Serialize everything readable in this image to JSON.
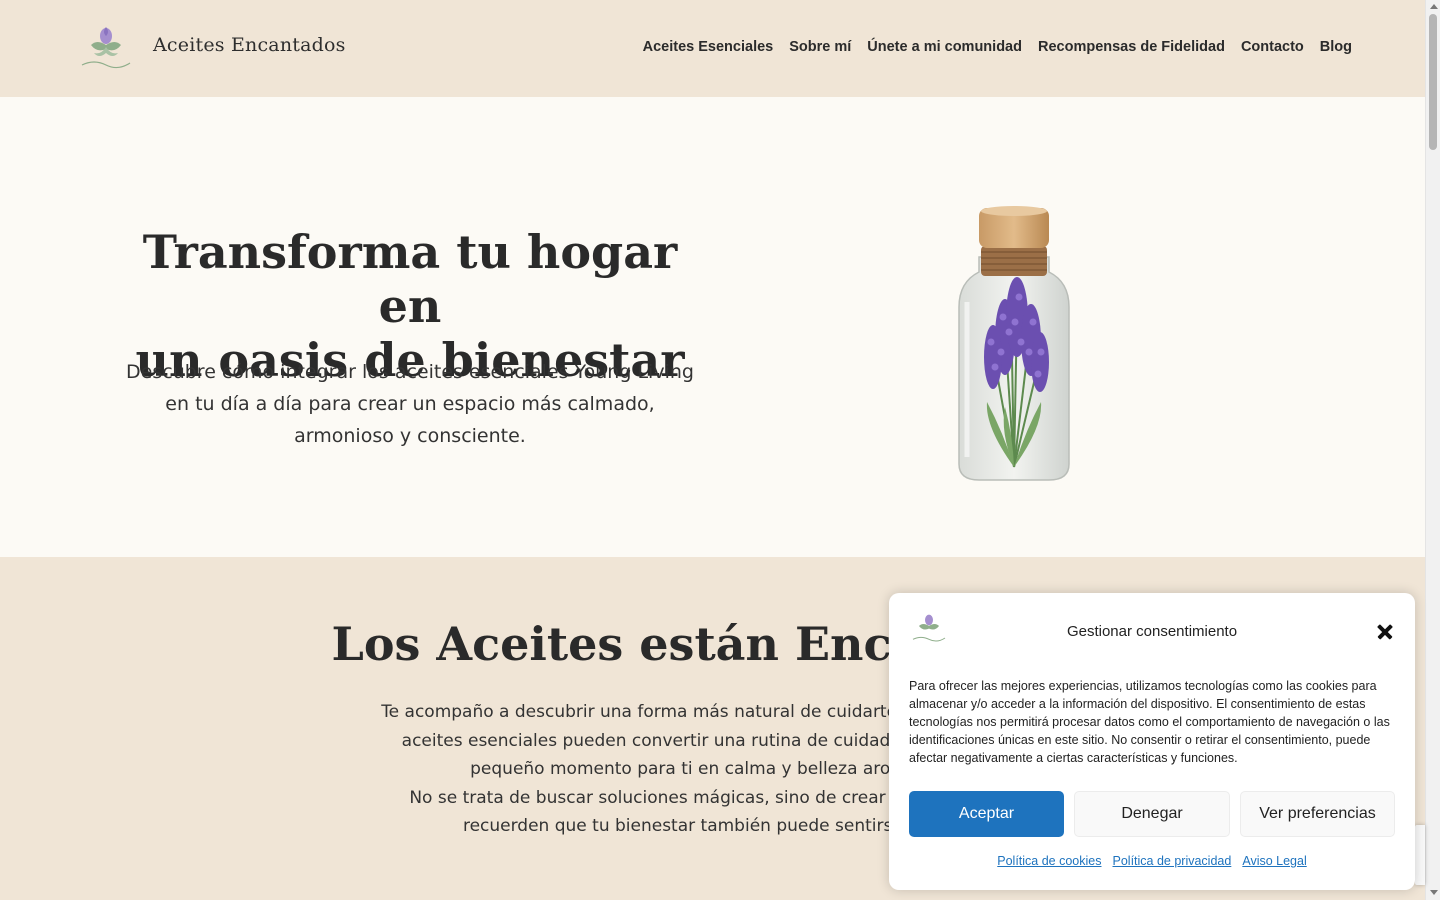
{
  "header": {
    "site_title": "Aceites Encantados",
    "logo_icon": "lavender-flower-logo",
    "nav": [
      {
        "label": "Aceites Esenciales"
      },
      {
        "label": "Sobre mí"
      },
      {
        "label": "Únete a mi comunidad"
      },
      {
        "label": "Recompensas de Fidelidad"
      },
      {
        "label": "Contacto"
      },
      {
        "label": "Blog"
      }
    ]
  },
  "hero": {
    "title_line1": "Transforma tu hogar en",
    "title_line2": "un oasis de bienestar",
    "subtitle": "Descubre cómo integrar los aceites esenciales Young Living en tu día a día para crear un espacio más calmado, armonioso y consciente.",
    "image_icon": "lavender-bottle-image"
  },
  "section2": {
    "title": "Los Aceites están Encantados",
    "paragraph1": "Te acompaño a descubrir una forma más natural de cuidarte. Gota a gota, los aceites esenciales pueden convertir una rutina de cuidado personal o un pequeño momento para ti en calma y belleza aromática.",
    "paragraph2": "No se trata de buscar soluciones mágicas, sino de crear rituales que te recuerden que tu bienestar también puede sentirse ligero."
  },
  "consent": {
    "title": "Gestionar consentimiento",
    "body": "Para ofrecer las mejores experiencias, utilizamos tecnologías como las cookies para almacenar y/o acceder a la información del dispositivo. El consentimiento de estas tecnologías nos permitirá procesar datos como el comportamiento de navegación o las identificaciones únicas en este sitio. No consentir o retirar el consentimiento, puede afectar negativamente a ciertas características y funciones.",
    "accept_label": "Aceptar",
    "deny_label": "Denegar",
    "prefs_label": "Ver preferencias",
    "links": [
      "Política de cookies",
      "Política de privacidad",
      "Aviso Legal"
    ],
    "accent_color": "#1e73be"
  }
}
